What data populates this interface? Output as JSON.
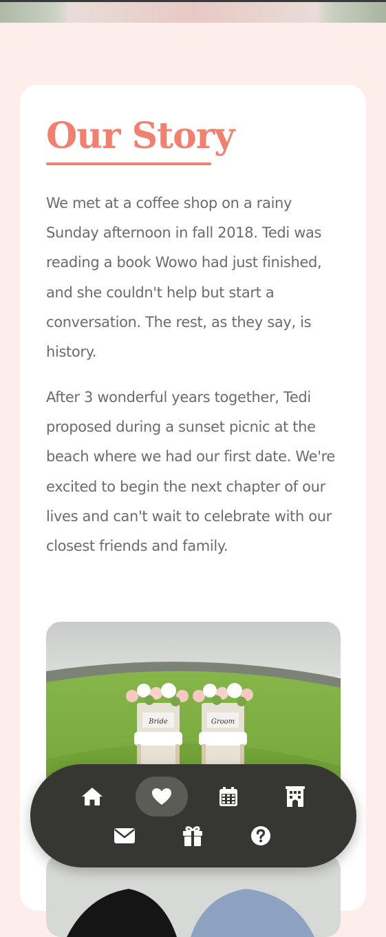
{
  "story": {
    "title": "Our Story",
    "paragraphs": [
      "We met at a coffee shop on a rainy Sunday afternoon in fall 2018. Tedi was reading a book Wowo had just finished, and she couldn't help but start a conversation. The rest, as they say, is history.",
      "After 3 wonderful years together, Tedi proposed during a sunset picnic at the beach where we had our first date. We're excited to begin the next chapter of our lives and can't wait to celebrate with our closest friends and family."
    ],
    "photo_sign_left": "Bride",
    "photo_sign_right": "Groom"
  },
  "colors": {
    "accent": "#f08070",
    "background": "#fdeeec",
    "nav_background": "#363732",
    "nav_active": "#5b5c56",
    "text": "#6b6b6b"
  },
  "nav": {
    "items": [
      {
        "icon": "home-icon",
        "active": false
      },
      {
        "icon": "heart-icon",
        "active": true
      },
      {
        "icon": "calendar-icon",
        "active": false
      },
      {
        "icon": "building-icon",
        "active": false
      },
      {
        "icon": "envelope-icon",
        "active": false
      },
      {
        "icon": "gift-icon",
        "active": false
      },
      {
        "icon": "question-icon",
        "active": false
      }
    ]
  }
}
